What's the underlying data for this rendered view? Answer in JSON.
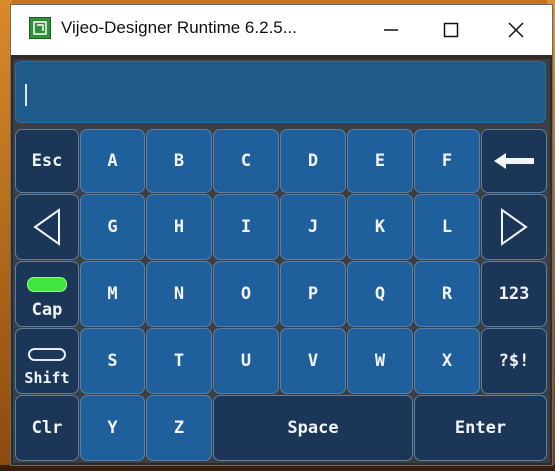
{
  "window": {
    "title": "Vijeo-Designer Runtime 6.2.5...",
    "minimize_icon": "minimize-icon",
    "maximize_icon": "maximize-icon",
    "close_icon": "close-icon",
    "app_icon": "vijeo-app-icon"
  },
  "keyboard": {
    "input_value": "",
    "row1": [
      "Esc",
      "A",
      "B",
      "C",
      "D",
      "E",
      "F"
    ],
    "row2": [
      "G",
      "H",
      "I",
      "J",
      "K",
      "L"
    ],
    "row3": [
      "M",
      "N",
      "O",
      "P",
      "Q",
      "R",
      "123"
    ],
    "row4": [
      "S",
      "T",
      "U",
      "V",
      "W",
      "X",
      "?$!"
    ],
    "row5": [
      "Clr",
      "Y",
      "Z",
      "Space",
      "Enter"
    ],
    "cap_label": "Cap",
    "cap_indicator_on": true,
    "shift_label": "Shift",
    "shift_indicator_on": false,
    "backspace_icon": "backspace-arrow-icon",
    "left_icon": "left-arrow-icon",
    "right_icon": "right-arrow-icon",
    "colors": {
      "key_blue": "#1f5f9c",
      "key_dark": "#1c3658",
      "indicator_on": "#3ee63e",
      "input_bg": "#1e5a8a"
    }
  }
}
